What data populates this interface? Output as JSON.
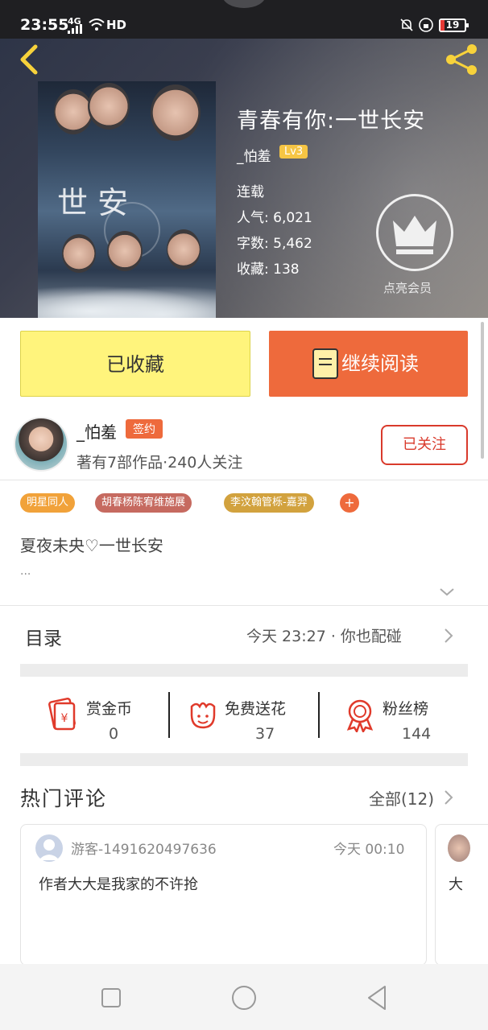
{
  "status_bar": {
    "time": "23:55",
    "network": "4G",
    "hd": "HD",
    "battery": "19"
  },
  "book": {
    "title": "青春有你:一世长安",
    "cover_text": "世 安",
    "author": "_怕羞",
    "level": "Lv3",
    "status": "连载",
    "popularity_label": "人气:",
    "popularity": "6,021",
    "words_label": "字数:",
    "words": "5,462",
    "favorites_label": "收藏:",
    "favorites": "138"
  },
  "vip": {
    "label": "点亮会员"
  },
  "actions": {
    "collected": "已收藏",
    "continue_reading": "继续阅读"
  },
  "author_info": {
    "name": "_怕羞",
    "badge": "签约",
    "stats": "著有7部作品·240人关注",
    "follow": "已关注"
  },
  "tags": [
    "明星同人",
    "胡春杨陈宥维施展",
    "李汶翰管栎-嘉羿",
    "+"
  ],
  "intro": {
    "text": "夏夜未央♡一世长安",
    "more": "..."
  },
  "toc": {
    "label": "目录",
    "latest": "今天 23:27 · 你也配碰"
  },
  "stats": [
    {
      "label": "赏金币",
      "value": "0"
    },
    {
      "label": "免费送花",
      "value": "37"
    },
    {
      "label": "粉丝榜",
      "value": "144"
    }
  ],
  "comments": {
    "title": "热门评论",
    "all": "全部(12)",
    "items": [
      {
        "user": "游客-1491620497636",
        "time": "今天 00:10",
        "text": "作者大大是我家的不许抢"
      },
      {
        "user": "",
        "time": "",
        "text": "大"
      }
    ]
  },
  "colors": {
    "accent": "#ee6a3c",
    "collect": "#fff47c",
    "follow": "#d93a2c"
  },
  "icons": [
    "back-icon",
    "share-icon",
    "crown-icon",
    "book-icon",
    "red-envelope-icon",
    "flower-icon",
    "medal-icon",
    "chevron-right-icon",
    "chevron-down-icon"
  ]
}
